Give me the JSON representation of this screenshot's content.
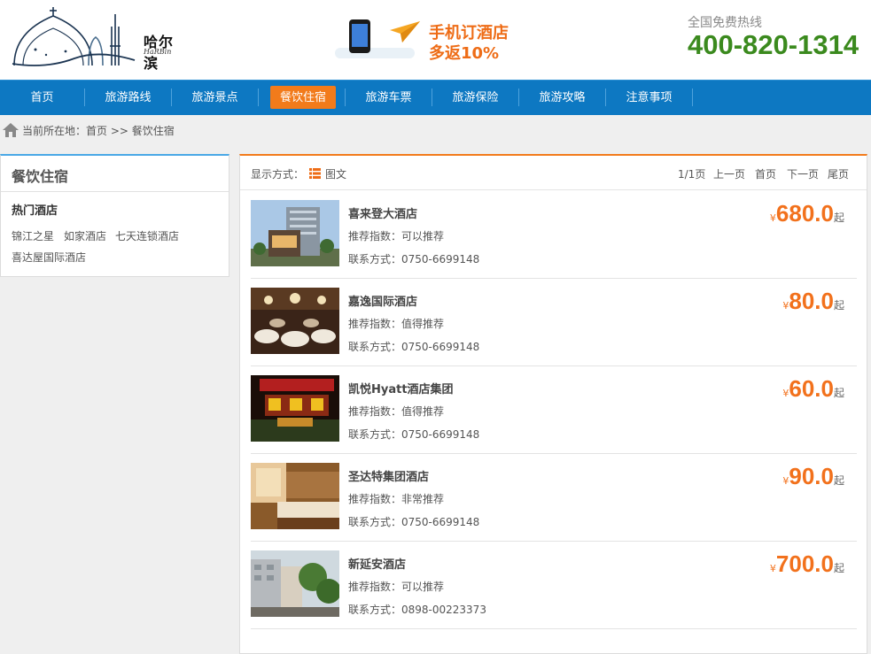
{
  "logo": {
    "cn": "哈尔滨",
    "en": "HaRBin"
  },
  "promo": {
    "line1": "手机订酒店",
    "line2": "多返10%"
  },
  "hotline": {
    "label": "全国免费热线",
    "number": "400-820-1314"
  },
  "nav": {
    "items": [
      "首页",
      "旅游路线",
      "旅游景点",
      "餐饮住宿",
      "旅游车票",
      "旅游保险",
      "旅游攻略",
      "注意事项"
    ],
    "active_index": 3
  },
  "breadcrumb": {
    "text": "当前所在地：首页 >> 餐饮住宿"
  },
  "sidebar": {
    "title": "餐饮住宿",
    "subtitle": "热门酒店",
    "links": [
      "锦江之星",
      "如家酒店",
      "七天连锁酒店",
      "喜达屋国际酒店"
    ]
  },
  "toolbar": {
    "display_label": "显示方式：",
    "display_value": "图文",
    "page_info": "1/1页",
    "prev": "上一页",
    "first": "首页",
    "next": "下一页",
    "last": "尾页"
  },
  "hotels": [
    {
      "name": "喜来登大酒店",
      "rec": "推荐指数：可以推荐",
      "contact": "联系方式：0750-6699148",
      "currency": "¥",
      "price": "680.0",
      "suffix": "起"
    },
    {
      "name": "嘉逸国际酒店",
      "rec": "推荐指数：值得推荐",
      "contact": "联系方式：0750-6699148",
      "currency": "¥",
      "price": "80.0",
      "suffix": "起"
    },
    {
      "name": "凯悦Hyatt酒店集团",
      "rec": "推荐指数：值得推荐",
      "contact": "联系方式：0750-6699148",
      "currency": "¥",
      "price": "60.0",
      "suffix": "起"
    },
    {
      "name": "圣达特集团酒店",
      "rec": "推荐指数：非常推荐",
      "contact": "联系方式：0750-6699148",
      "currency": "¥",
      "price": "90.0",
      "suffix": "起"
    },
    {
      "name": "新延安酒店",
      "rec": "推荐指数：可以推荐",
      "contact": "联系方式：0898-00223373",
      "currency": "¥",
      "price": "700.0",
      "suffix": "起"
    }
  ],
  "colors": {
    "nav_bg": "#0d78c2",
    "accent_orange": "#f27b1b",
    "price_orange": "#f2711c",
    "hotline_green": "#3b8a1e"
  }
}
